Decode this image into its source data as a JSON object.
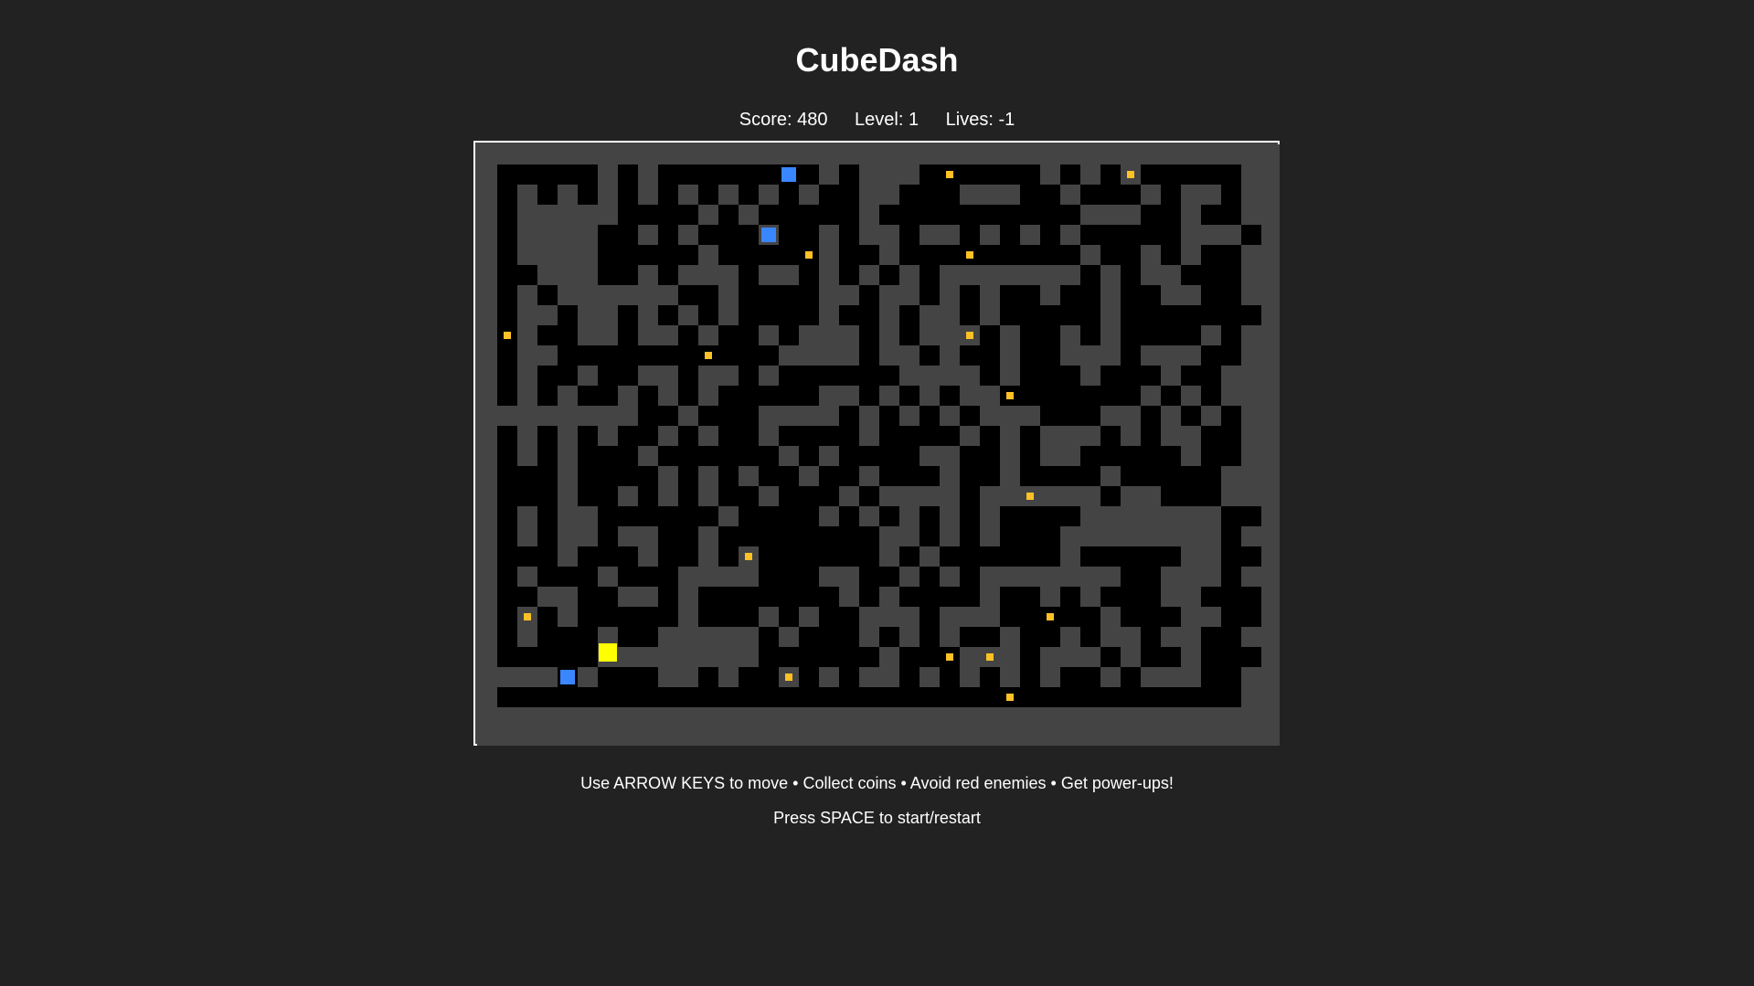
{
  "game": {
    "title": "CubeDash",
    "hud": {
      "score_label": "Score: 480",
      "level_label": "Level: 1",
      "lives_label": "Lives: -1"
    },
    "instructions": "Use ARROW KEYS to move • Collect coins • Avoid red enemies • Get power-ups!",
    "hint": "Press SPACE to start/restart"
  },
  "colors": {
    "background": "#222222",
    "wall": "#444444",
    "floor": "#000000",
    "coin": "#FFC125",
    "player": "#FFFF00",
    "enemy": "#3A86FF",
    "border": "#FFFFFF"
  },
  "maze": {
    "cols": 39,
    "rows": 29,
    "grid": [
      "111111111111111111111111111111111111111",
      "100000101000000001011100000010101000001",
      "101010101010101010011000111001000101101",
      "101111100001010000010000000000111001001",
      "101111001010001001011011010101000001110",
      "101111000001000001001000000000100101001",
      "100111001011101101010101111111010110001",
      "101011111100100001101101010010010011001",
      "101101101010100001001011010000010000000",
      "101001101101001011101011101001010000101",
      "101100000000000111101101001001110111001",
      "101001001101101000000111101000100010011",
      "101010010101000001101010110000000101011",
      "111111110010001111010101011100011010101",
      "101010100101001000010000101011101011001",
      "101010001000000101000011001011000001001",
      "100010000101010010010001001000010000011",
      "100010010101001000101111011111101100011",
      "101011000000100001010101010000111111100",
      "101011011001000000001101010001111111101",
      "100010001001010000001010000001000001100",
      "101000100011110001100101011111110011101",
      "100110011010000000101000010010100011000",
      "101010000010001010011101110000010001100",
      "101000100111110100010101001001011011001",
      "100000111111110000001000111011101001000",
      "111101000110100101011010101010010111001",
      "100000000000000000000000000000000000001",
      "111111111111111111111111111111111111111"
    ]
  },
  "entities": {
    "player": [
      [
        6,
        25
      ]
    ],
    "enemies": [
      [
        15,
        1
      ],
      [
        14,
        4
      ],
      [
        4,
        26
      ]
    ],
    "coins": [
      [
        23,
        1
      ],
      [
        32,
        1
      ],
      [
        16,
        5
      ],
      [
        24,
        5
      ],
      [
        1,
        9
      ],
      [
        24,
        9
      ],
      [
        11,
        10
      ],
      [
        26,
        12
      ],
      [
        27,
        17
      ],
      [
        13,
        20
      ],
      [
        2,
        23
      ],
      [
        28,
        23
      ],
      [
        23,
        25
      ],
      [
        25,
        25
      ],
      [
        15,
        26
      ],
      [
        26,
        27
      ]
    ]
  }
}
